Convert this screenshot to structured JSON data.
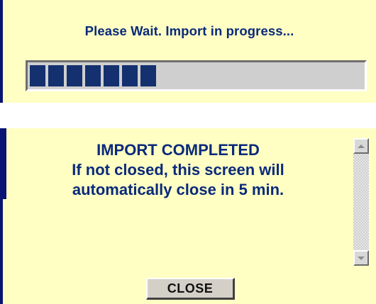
{
  "progress_panel": {
    "message": "Please Wait. Import in progress...",
    "progress_blocks_filled": 7,
    "progress_fraction": 0.4
  },
  "complete_panel": {
    "heading": "IMPORT COMPLETED",
    "line1": "If not closed, this screen will",
    "line2": "automatically close in 5 min.",
    "close_label": "CLOSE"
  },
  "scrollbar": {
    "up_icon": "scroll-up-arrow",
    "down_icon": "scroll-down-arrow"
  },
  "colors": {
    "panel_background": "#ffffc4",
    "accent_border": "#0a1473",
    "text": "#0a2a7a",
    "progress_fill": "#14306e"
  }
}
